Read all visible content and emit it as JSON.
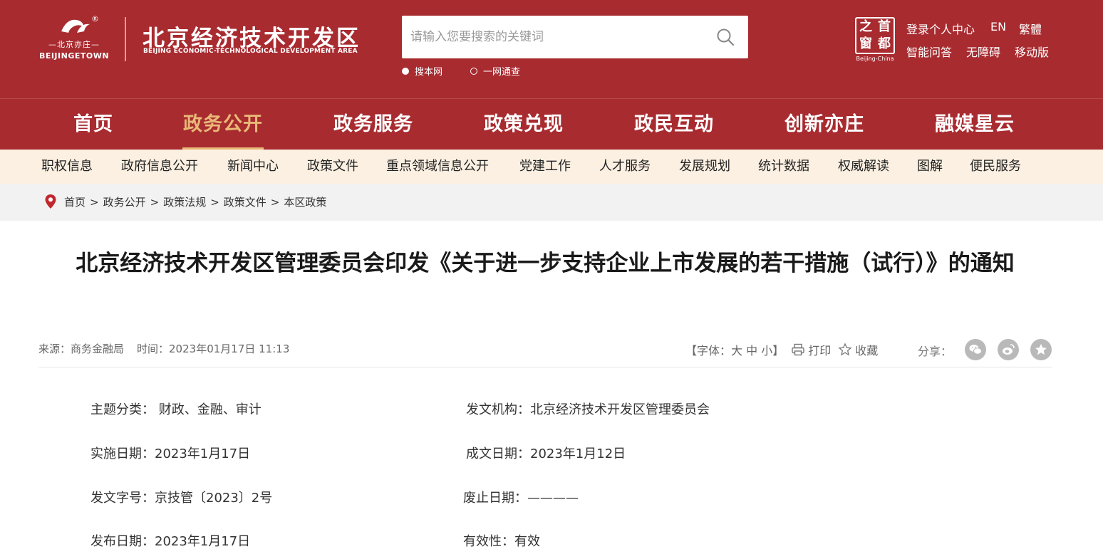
{
  "colors": {
    "brand_red": "#a82b30",
    "accent_gold": "#e9b877",
    "subnav_bg": "#fbf0e2",
    "crumb_bg": "#f2f2f2"
  },
  "logo": {
    "cn_small": "—北京亦庄—",
    "en_small": "BEIJINGETOWN",
    "reg": "®",
    "title": "北京经济技术开发区",
    "subtitle": "BEIJING ECONOMIC-TECHNOLOGICAL DEVELOPMENT AREA"
  },
  "search": {
    "placeholder": "请输入您要搜索的关键词",
    "value": "",
    "icon": "search-icon",
    "scopes": [
      {
        "label": "搜本网",
        "selected": true
      },
      {
        "label": "一网通查",
        "selected": false
      }
    ]
  },
  "capital_logo": {
    "chars": [
      "之",
      "首",
      "窗",
      "都"
    ],
    "en": "Beijing-China"
  },
  "top_links": {
    "row1": [
      "登录个人中心",
      "EN",
      "繁體"
    ],
    "row2": [
      "智能问答",
      "无障碍",
      "移动版"
    ]
  },
  "main_nav": [
    "首页",
    "政务公开",
    "政务服务",
    "政策兑现",
    "政民互动",
    "创新亦庄",
    "融媒星云"
  ],
  "main_nav_active": 1,
  "sub_nav": [
    "职权信息",
    "政府信息公开",
    "新闻中心",
    "政策文件",
    "重点领域信息公开",
    "党建工作",
    "人才服务",
    "发展规划",
    "统计数据",
    "权威解读",
    "图解",
    "便民服务"
  ],
  "breadcrumb": [
    "首页",
    "政务公开",
    "政策法规",
    "政策文件",
    "本区政策"
  ],
  "breadcrumb_sep": ">",
  "article": {
    "title": "北京经济技术开发区管理委员会印发《关于进一步支持企业上市发展的若干措施（试行）》的通知",
    "source": "来源：商务金融局",
    "time": "时间：2023年01月17日 11:13",
    "font_size": {
      "label": "【字体：",
      "large": "大",
      "medium": "中",
      "small": "小",
      "end": "】"
    },
    "print": "打印",
    "favorite": "收藏",
    "share_label": "分享：",
    "share_icons": [
      "wechat-icon",
      "weibo-icon",
      "favorite-star-icon"
    ]
  },
  "info": [
    [
      "主题分类：  财政、金融、审计",
      "发文机构：北京经济技术开发区管理委员会"
    ],
    [
      "实施日期：2023年1月17日",
      "成文日期：2023年1月12日"
    ],
    [
      "发文字号：京技管〔2023〕2号",
      "废止日期：————"
    ],
    [
      "发布日期：2023年1月17日",
      "有效性：有效"
    ]
  ]
}
